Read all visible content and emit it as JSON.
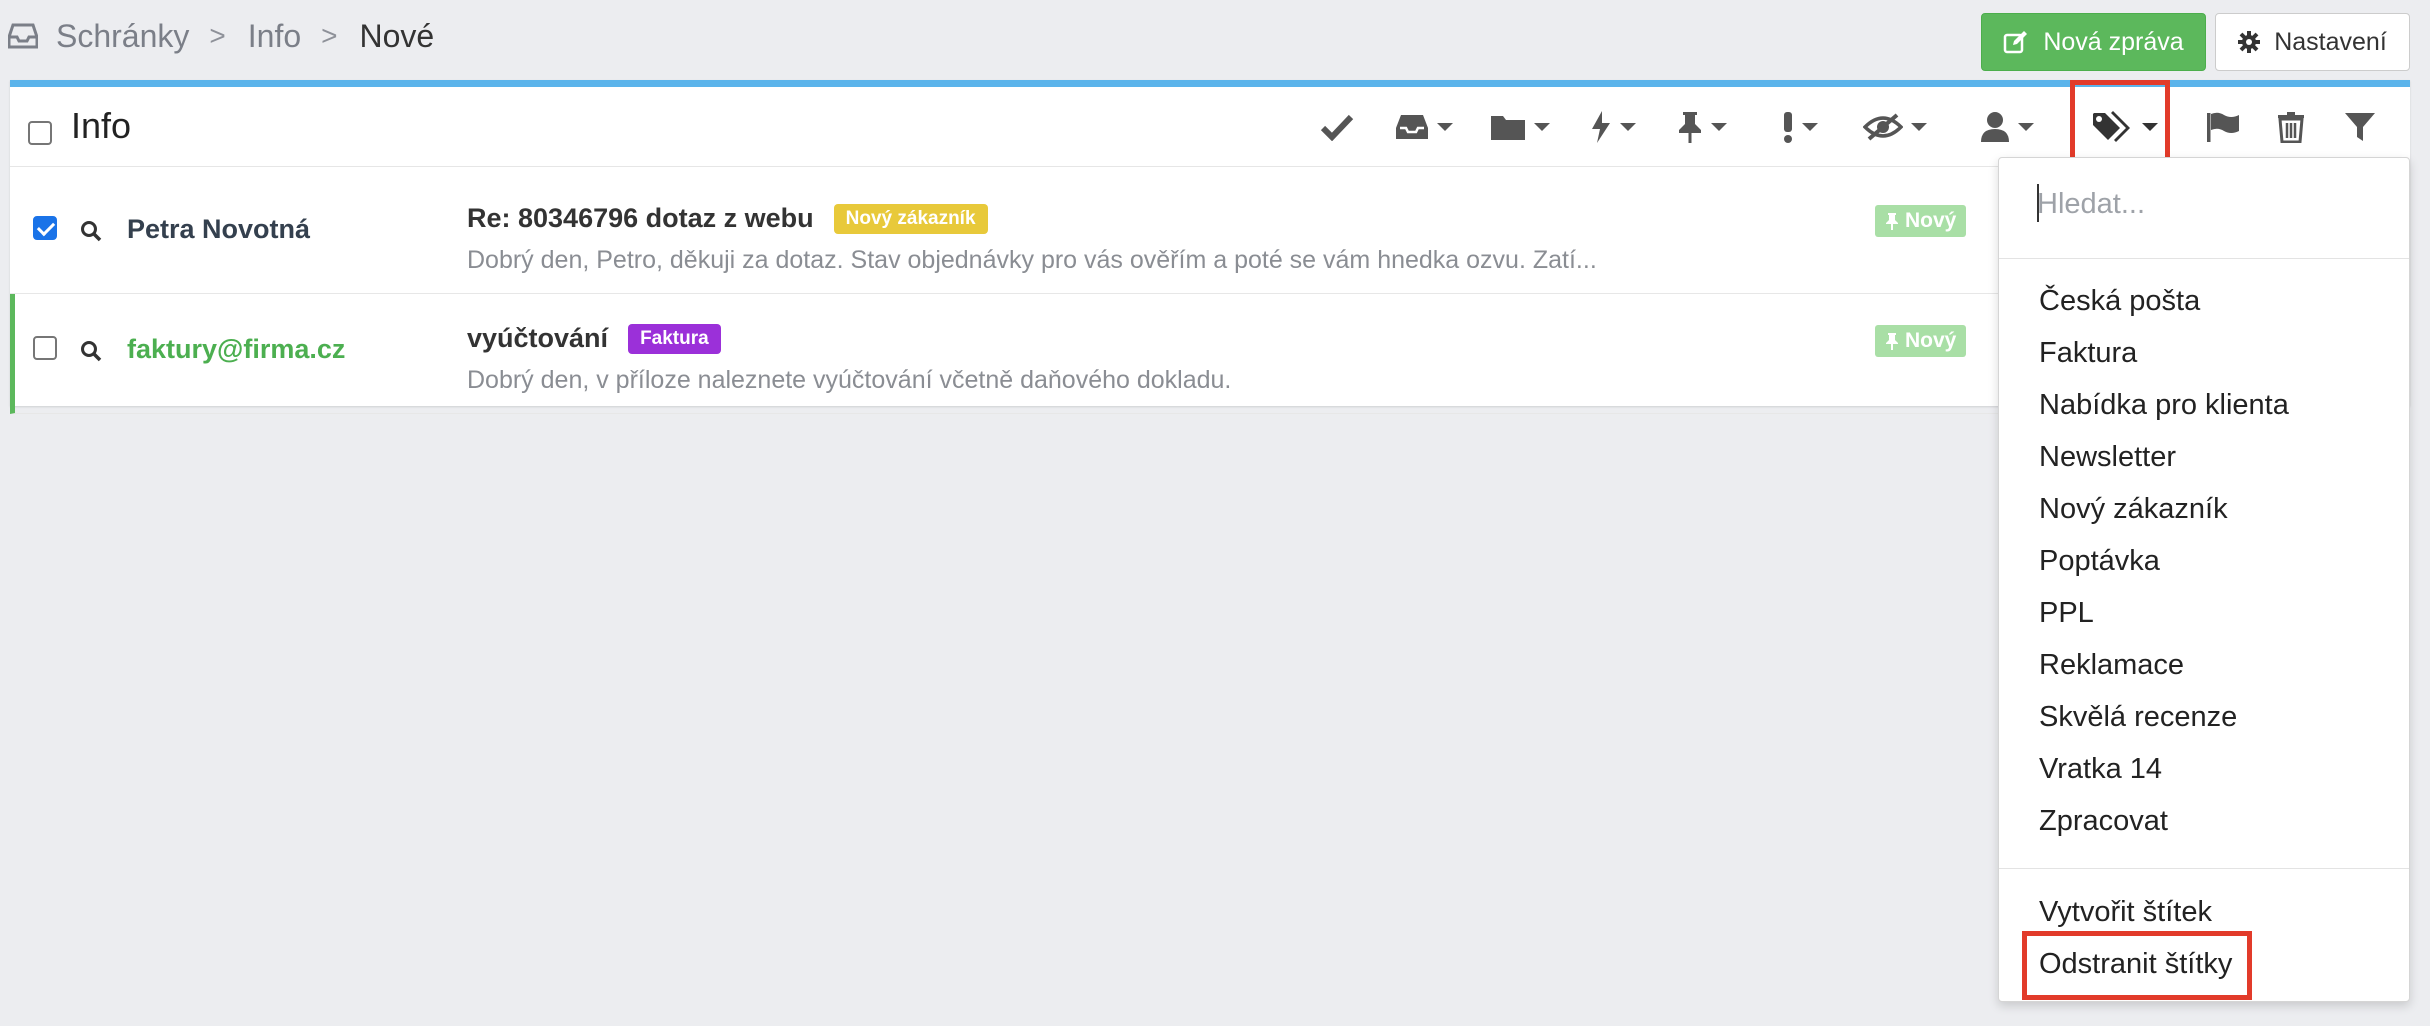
{
  "breadcrumb": {
    "root": "Schránky",
    "middle": "Info",
    "current": "Nové",
    "separator": ">"
  },
  "header_buttons": {
    "new_message": "Nová zpráva",
    "settings": "Nastavení"
  },
  "panel": {
    "title": "Info"
  },
  "toolbar_icons": [
    "check-icon",
    "inbox-icon",
    "folder-icon",
    "bolt-icon",
    "pin-icon",
    "exclamation-icon",
    "eye-slash-icon",
    "user-icon",
    "tags-icon",
    "flag-icon",
    "trash-icon",
    "filter-icon"
  ],
  "messages": [
    {
      "sender": "Petra Novotná",
      "subject": "Re: 80346796 dotaz z webu",
      "label": "Nový zákazník",
      "preview": "Dobrý den, Petro,  děkuji za dotaz.  Stav objednávky pro vás ověřím a poté se vám hnedka ozvu.  Zatí...",
      "status": "Nový",
      "checked": true
    },
    {
      "sender": "faktury@firma.cz",
      "subject": "vyúčtování",
      "label": "Faktura",
      "preview": "Dobrý den, v příloze naleznete vyúčtování včetně daňového dokladu.",
      "status": "Nový",
      "checked": false
    }
  ],
  "tag_dropdown": {
    "search_placeholder": "Hledat...",
    "tags": [
      "Česká pošta",
      "Faktura",
      "Nabídka pro klienta",
      "Newsletter",
      "Nový zákazník",
      "Poptávka",
      "PPL",
      "Reklamace",
      "Skvělá recenze",
      "Vratka 14",
      "Zpracovat"
    ],
    "actions": {
      "create": "Vytvořit štítek",
      "remove": "Odstranit štítky"
    }
  },
  "colors": {
    "accent_bar": "#5bb4eb",
    "new_button": "#5cb85c",
    "label_new_customer": "#e8c93a",
    "label_invoice": "#9b30d9",
    "status_badge": "#a9dfa6",
    "sender_green": "#4caf50",
    "highlight": "#e23b2a"
  }
}
